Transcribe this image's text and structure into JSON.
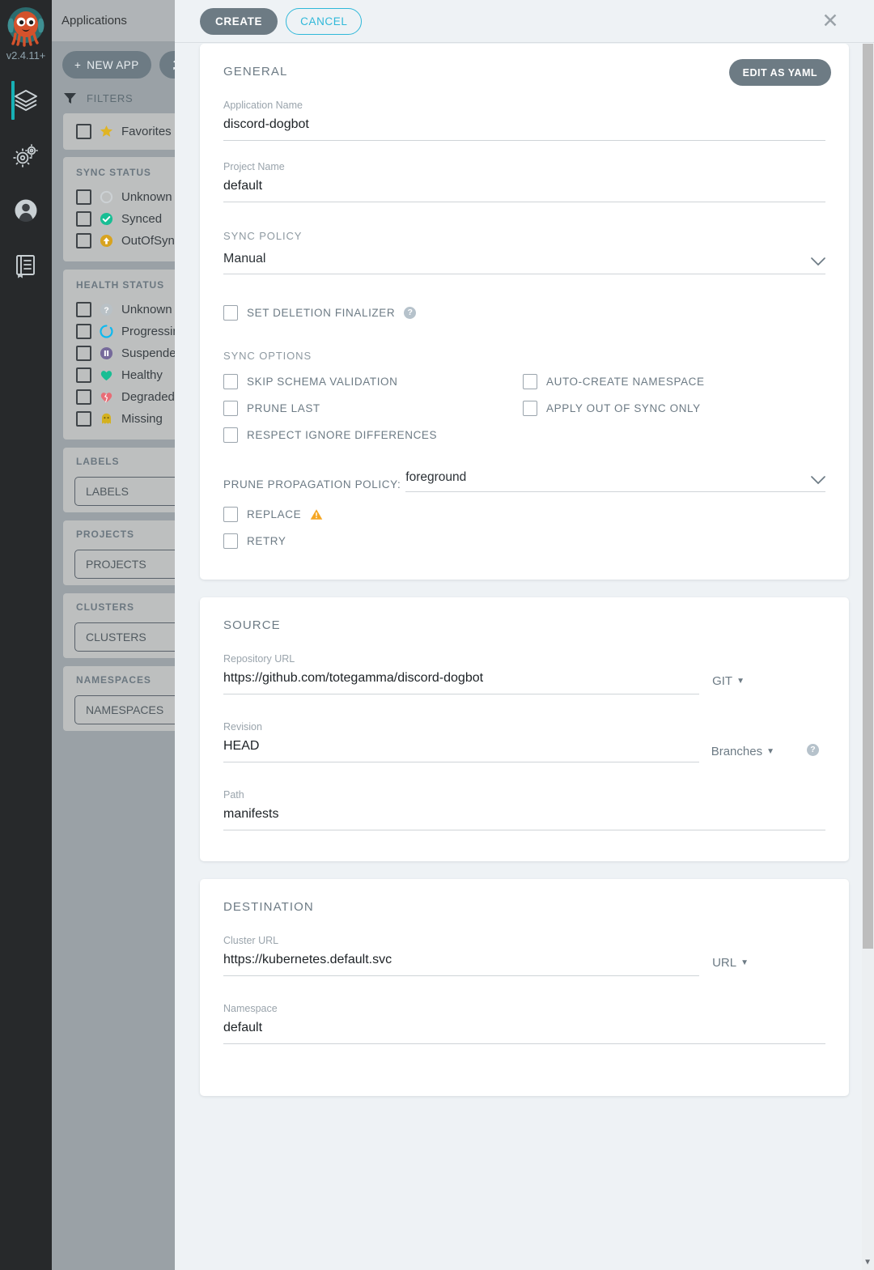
{
  "app": {
    "version_label": "v2.4.11+",
    "logo_name": "argo-octopus-logo"
  },
  "nav_rail": {
    "items": [
      {
        "name": "applications",
        "icon": "layers-icon",
        "active": true
      },
      {
        "name": "settings",
        "icon": "gear-icon",
        "active": false
      },
      {
        "name": "user-info",
        "icon": "user-icon",
        "active": false
      },
      {
        "name": "documentation",
        "icon": "book-icon",
        "active": false
      }
    ]
  },
  "sidebar": {
    "title": "Applications",
    "new_app_label": "NEW APP",
    "new_app_icon": "plus-icon",
    "sync_button_label": "S",
    "sync_button_icon": "refresh-icon",
    "filters_label": "FILTERS",
    "filters_icon": "funnel-icon",
    "favorites": {
      "label": "Favorites On",
      "icon": "star-icon"
    },
    "groups": [
      {
        "title": "SYNC STATUS",
        "items": [
          {
            "label": "Unknown",
            "icon": "circle-outline-icon",
            "color": "#ccd1d4"
          },
          {
            "label": "Synced",
            "icon": "check-circle-icon",
            "color": "#18be94"
          },
          {
            "label": "OutOfSync",
            "icon": "arrow-up-circle-icon",
            "color": "#d8a31f"
          }
        ]
      },
      {
        "title": "HEALTH STATUS",
        "items": [
          {
            "label": "Unknown",
            "icon": "question-circle-icon",
            "color": "#b9c1c6"
          },
          {
            "label": "Progressing",
            "icon": "spinner-circle-icon",
            "color": "#0db9f0"
          },
          {
            "label": "Suspended",
            "icon": "pause-circle-icon",
            "color": "#766a9b"
          },
          {
            "label": "Healthy",
            "icon": "heart-icon",
            "color": "#18be94"
          },
          {
            "label": "Degraded",
            "icon": "broken-heart-icon",
            "color": "#e96d76"
          },
          {
            "label": "Missing",
            "icon": "ghost-icon",
            "color": "#d4b11f"
          }
        ]
      }
    ],
    "text_filters": [
      {
        "title": "LABELS",
        "placeholder": "LABELS"
      },
      {
        "title": "PROJECTS",
        "placeholder": "PROJECTS"
      },
      {
        "title": "CLUSTERS",
        "placeholder": "CLUSTERS"
      },
      {
        "title": "NAMESPACES",
        "placeholder": "NAMESPACES"
      }
    ]
  },
  "modal": {
    "create_label": "CREATE",
    "cancel_label": "CANCEL",
    "close_icon": "close-icon",
    "general": {
      "section_title": "GENERAL",
      "edit_yaml_label": "EDIT AS YAML",
      "app_name": {
        "label": "Application Name",
        "value": "discord-dogbot"
      },
      "project_name": {
        "label": "Project Name",
        "value": "default"
      },
      "sync_policy": {
        "label": "SYNC POLICY",
        "value": "Manual"
      },
      "deletion_finalizer": {
        "label": "SET DELETION FINALIZER",
        "checked": false
      },
      "sync_options_label": "SYNC OPTIONS",
      "sync_options_left": [
        {
          "label": "SKIP SCHEMA VALIDATION",
          "checked": false
        },
        {
          "label": "PRUNE LAST",
          "checked": false
        },
        {
          "label": "RESPECT IGNORE DIFFERENCES",
          "checked": false
        }
      ],
      "sync_options_right": [
        {
          "label": "AUTO-CREATE NAMESPACE",
          "checked": false
        },
        {
          "label": "APPLY OUT OF SYNC ONLY",
          "checked": false
        }
      ],
      "prune_propagation": {
        "label": "PRUNE PROPAGATION POLICY:",
        "value": "foreground"
      },
      "replace": {
        "label": "REPLACE",
        "checked": false,
        "icon": "warning-triangle-icon"
      },
      "retry": {
        "label": "RETRY",
        "checked": false
      }
    },
    "source": {
      "section_title": "SOURCE",
      "repo_url": {
        "label": "Repository URL",
        "value": "https://github.com/totegamma/discord-dogbot",
        "type": "GIT"
      },
      "revision": {
        "label": "Revision",
        "value": "HEAD",
        "type": "Branches"
      },
      "path": {
        "label": "Path",
        "value": "manifests"
      }
    },
    "destination": {
      "section_title": "DESTINATION",
      "cluster_url": {
        "label": "Cluster URL",
        "value": "https://kubernetes.default.svc",
        "type": "URL"
      },
      "namespace": {
        "label": "Namespace",
        "value": "default"
      }
    }
  },
  "colors": {
    "accent_teal": "#17b0b5",
    "cancel_blue": "#2fb8d9",
    "button_slate": "#6d7b84",
    "nav_dark": "#27292b",
    "overlay_bg": "#eef2f5"
  }
}
